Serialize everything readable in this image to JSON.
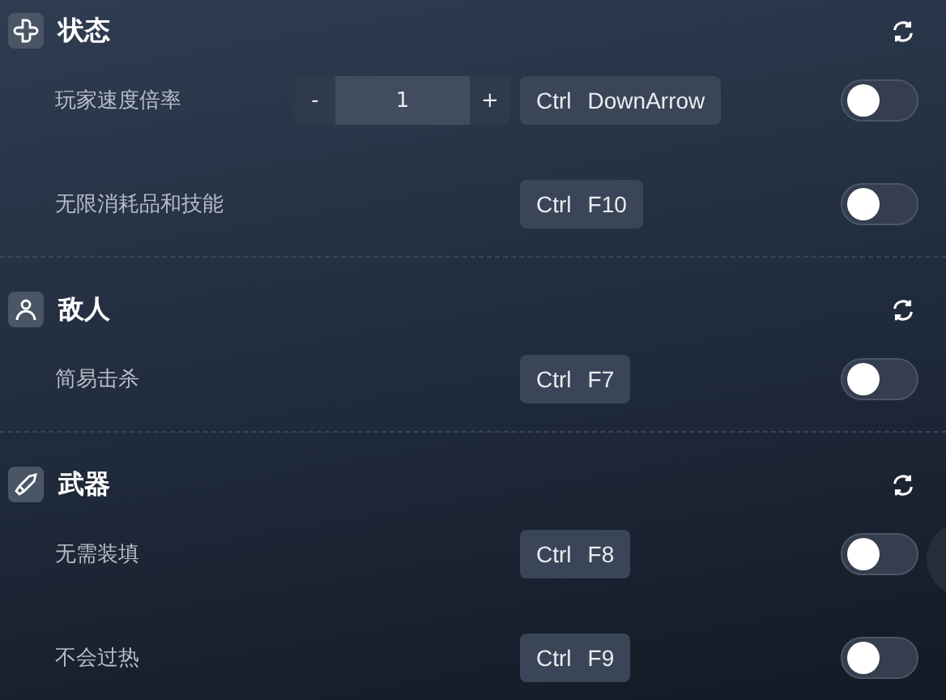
{
  "sections": [
    {
      "title": "状态",
      "rows": [
        {
          "label": "玩家速度倍率",
          "stepper": {
            "minus": "-",
            "value": "1",
            "plus": "+"
          },
          "keys": [
            "Ctrl",
            "DownArrow"
          ],
          "on": false
        },
        {
          "label": "无限消耗品和技能",
          "keys": [
            "Ctrl",
            "F10"
          ],
          "on": false
        }
      ]
    },
    {
      "title": "敌人",
      "rows": [
        {
          "label": "简易击杀",
          "keys": [
            "Ctrl",
            "F7"
          ],
          "on": false
        }
      ]
    },
    {
      "title": "武器",
      "rows": [
        {
          "label": "无需装填",
          "keys": [
            "Ctrl",
            "F8"
          ],
          "on": false
        },
        {
          "label": "不会过热",
          "keys": [
            "Ctrl",
            "F9"
          ],
          "on": false
        }
      ]
    }
  ]
}
